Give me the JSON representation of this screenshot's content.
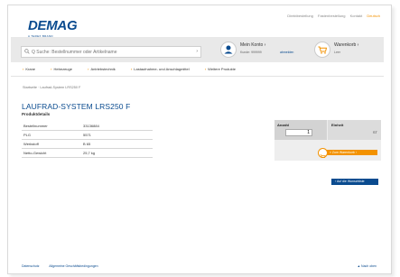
{
  "top_links": [
    "Direktbestellung",
    "Fastenbestellung",
    "Kontakt",
    "Deutsch"
  ],
  "logo": {
    "text": "DEMAG",
    "tagline": "A TEREX BRAND"
  },
  "search": {
    "placeholder": "Q Suche: Bestellnummer oder Artikelname",
    "go": "›"
  },
  "account": {
    "title": "Mein Konto ›",
    "number": "Kunde: 999999",
    "logout": "abmelden"
  },
  "cart": {
    "title": "Warenkorb ›",
    "status": "Leer"
  },
  "nav": [
    "Krane",
    "Hebezeuge",
    "Antriebstechnik",
    "Lastaufnahme- und Anschlagmittel",
    "Weitere Produkte"
  ],
  "breadcrumb": "Startseite · Laufrad-System LRS250 F",
  "product": {
    "title": "LAUFRAD-SYSTEM LRS250 F",
    "subtitle": "Produktdetails",
    "rows": [
      {
        "k": "Bestellnummer",
        "v": "33136884"
      },
      {
        "k": "PLG",
        "v": "5571"
      },
      {
        "k": "Werkstoff",
        "v": "B 65"
      },
      {
        "k": "Netto-Gewicht",
        "v": "25,7 kg"
      }
    ]
  },
  "order": {
    "qty_label": "Anzahl",
    "qty_value": "1",
    "unit_label": "Einheit",
    "unit_value": "ST",
    "add_to_cart": "» Zum Warenkorb ›",
    "wishlist": "› Auf die Wunschliste"
  },
  "footer": {
    "links": [
      "Datenschutz",
      "Allgemeine Geschäftsbedingungen"
    ],
    "top": "▲ Nach oben"
  }
}
